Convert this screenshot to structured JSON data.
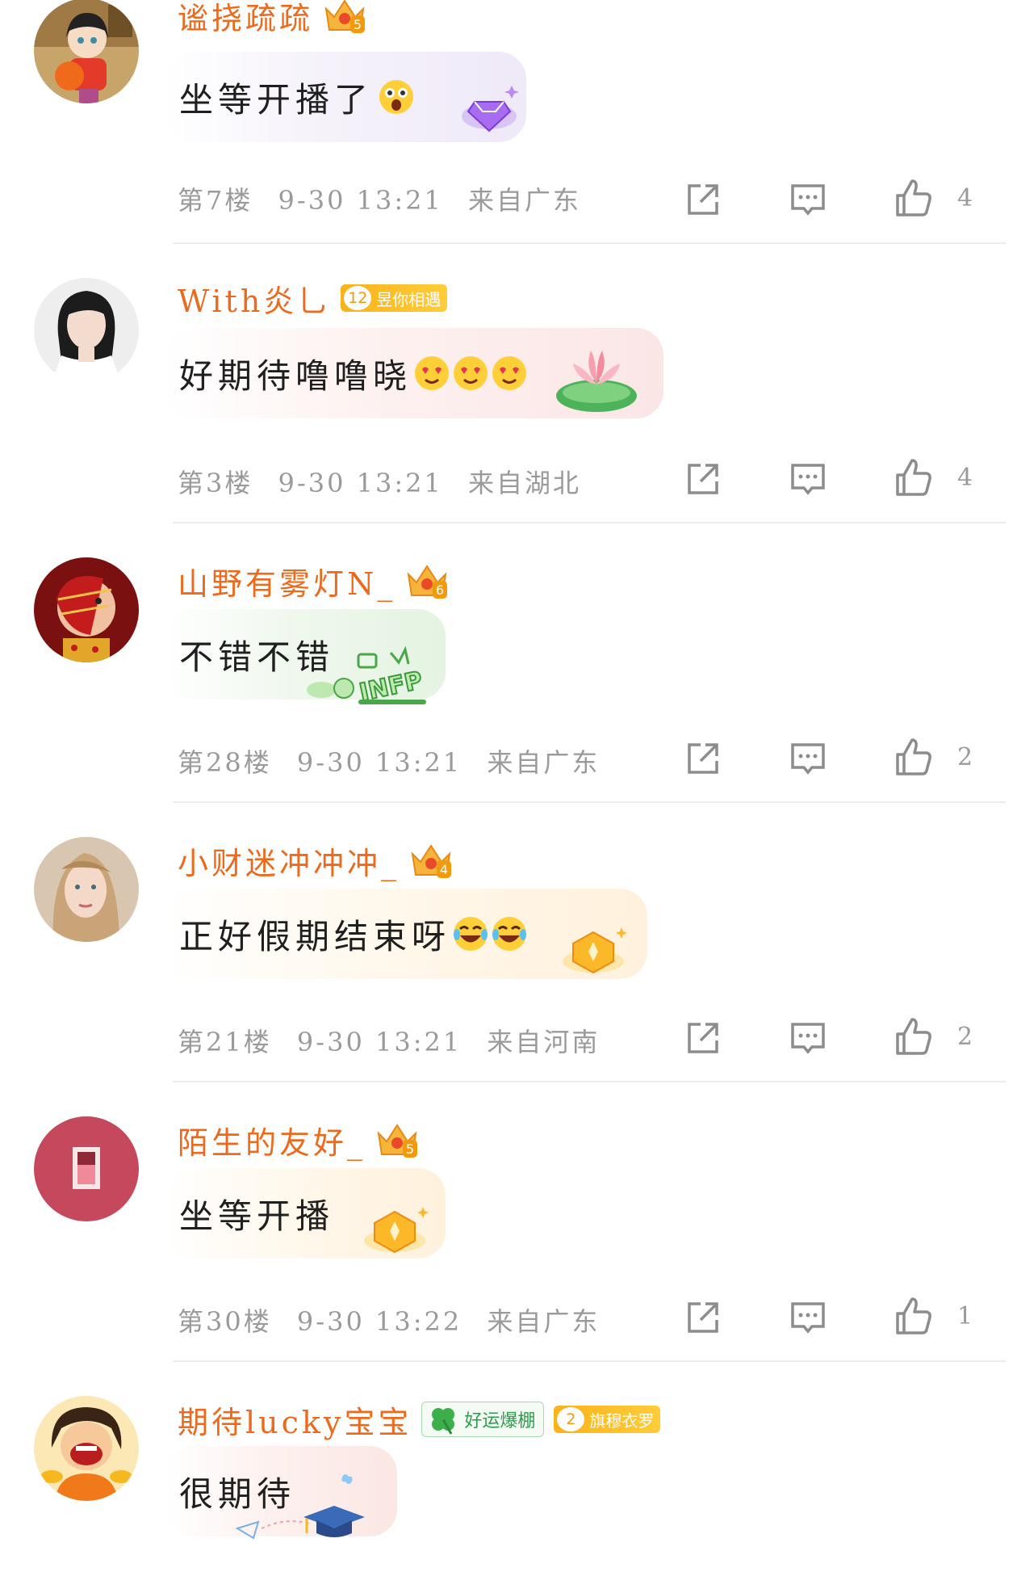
{
  "comments": [
    {
      "name": "谧挠疏疏",
      "crown_level": "5",
      "text": "坐等开播了",
      "floor": "第7楼",
      "time": "9-30 13:21",
      "location": "来自广东",
      "likes": "4"
    },
    {
      "name": "With炎乚",
      "fan_badge": {
        "level": "12",
        "label": "昱你相遇"
      },
      "text": "好期待噜噜晓",
      "floor": "第3楼",
      "time": "9-30 13:21",
      "location": "来自湖北",
      "likes": "4"
    },
    {
      "name": "山野有雾灯N_",
      "crown_level": "6",
      "text": "不错不错",
      "floor": "第28楼",
      "time": "9-30 13:21",
      "location": "来自广东",
      "likes": "2"
    },
    {
      "name": "小财迷冲冲冲_",
      "crown_level": "4",
      "text": "正好假期结束呀",
      "floor": "第21楼",
      "time": "9-30 13:21",
      "location": "来自河南",
      "likes": "2"
    },
    {
      "name": "陌生的友好_",
      "crown_level": "5",
      "text": "坐等开播",
      "floor": "第30楼",
      "time": "9-30 13:22",
      "location": "来自广东",
      "likes": "1"
    },
    {
      "name": "期待lucky宝宝",
      "lucky_badge": "好运爆棚",
      "fan_badge": {
        "level": "2",
        "label": "旗穆衣罗"
      },
      "text": "很期待"
    }
  ],
  "colors": {
    "username": "#ec6a1e",
    "meta": "#9a9a9a",
    "divider": "#ececec"
  },
  "icons": [
    "share-icon",
    "reply-icon",
    "like-icon",
    "crown-icon"
  ]
}
